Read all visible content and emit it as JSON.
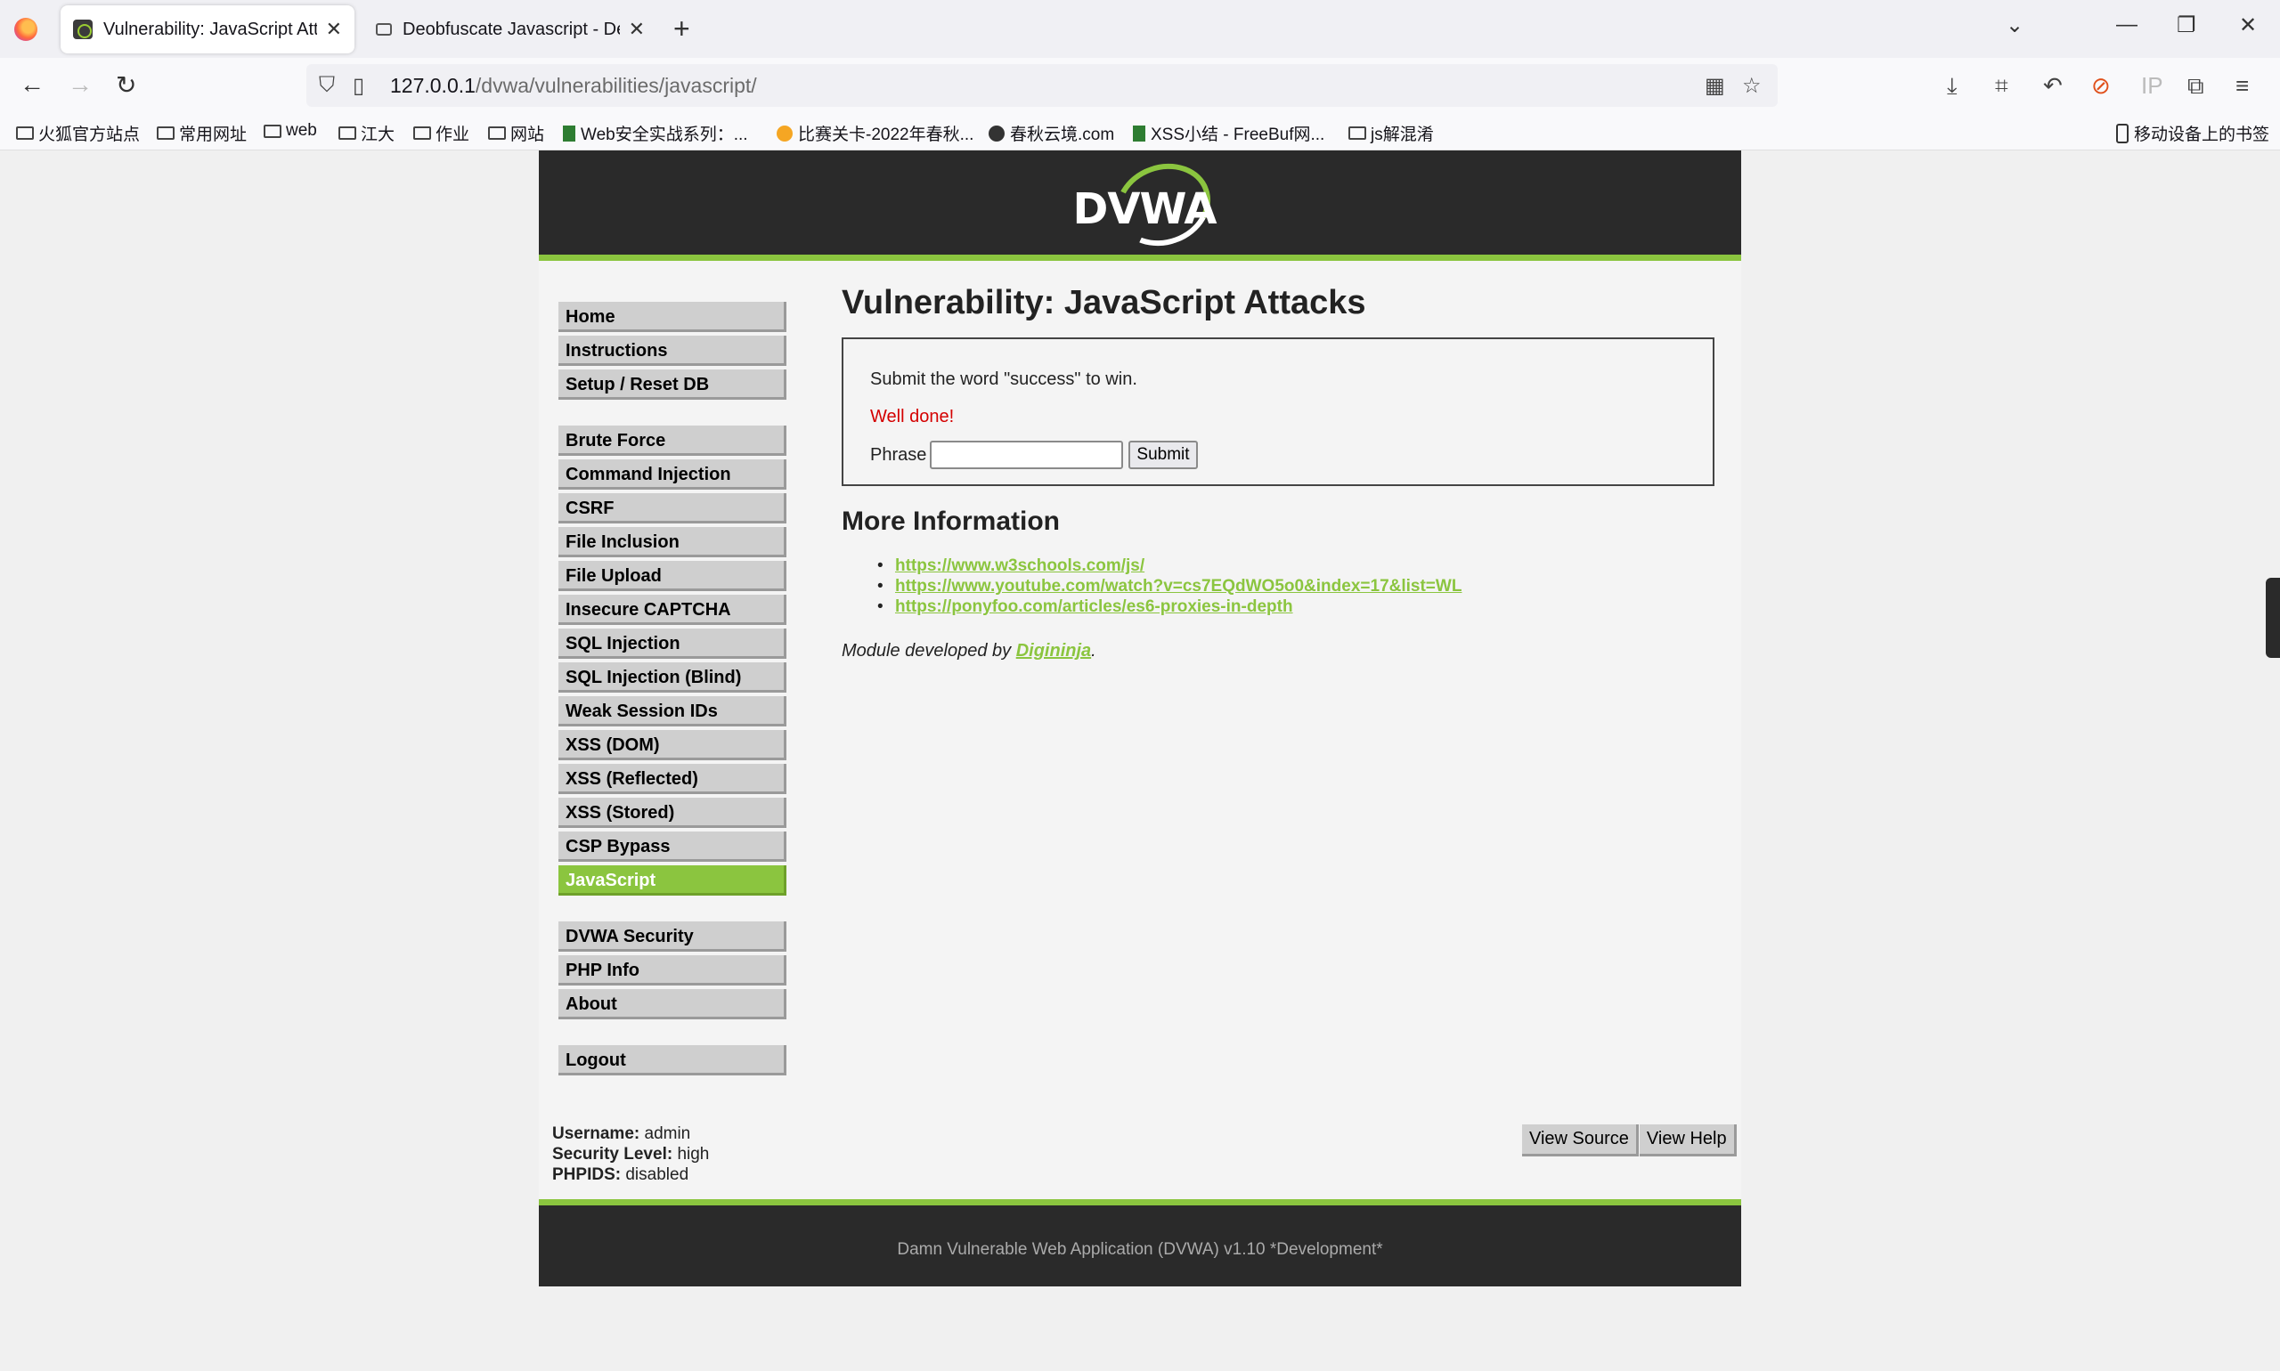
{
  "browser": {
    "tabs": [
      {
        "title": "Vulnerability: JavaScript Attac",
        "active": true
      },
      {
        "title": "Deobfuscate Javascript - Deo",
        "active": false
      }
    ],
    "new_tab": "+",
    "controls": {
      "list": "⌄",
      "minimize": "—",
      "restore": "❐",
      "close": "✕"
    },
    "url": {
      "host": "127.0.0.1",
      "path": "/dvwa/vulnerabilities/javascript/"
    },
    "toolbar_ip": "IP",
    "bookmarks": [
      {
        "label": "火狐官方站点",
        "icon": "folder-icon"
      },
      {
        "label": "常用网址",
        "icon": "folder-icon"
      },
      {
        "label": "web",
        "icon": "folder-icon"
      },
      {
        "label": "江大",
        "icon": "folder-icon"
      },
      {
        "label": "作业",
        "icon": "folder-icon"
      },
      {
        "label": "网站",
        "icon": "folder-icon"
      },
      {
        "label": "Web安全实战系列：...",
        "icon": "site-icon"
      },
      {
        "label": "比赛关卡-2022年春秋...",
        "icon": "site-icon"
      },
      {
        "label": "春秋云境.com",
        "icon": "site-icon"
      },
      {
        "label": "XSS小结 - FreeBuf网...",
        "icon": "site-icon"
      },
      {
        "label": "js解混淆",
        "icon": "folder-icon"
      },
      {
        "label": "移动设备上的书签",
        "icon": "phone-icon"
      }
    ]
  },
  "dvwa": {
    "logo": "DVWA",
    "menu": {
      "group1": [
        "Home",
        "Instructions",
        "Setup / Reset DB"
      ],
      "group2": [
        "Brute Force",
        "Command Injection",
        "CSRF",
        "File Inclusion",
        "File Upload",
        "Insecure CAPTCHA",
        "SQL Injection",
        "SQL Injection (Blind)",
        "Weak Session IDs",
        "XSS (DOM)",
        "XSS (Reflected)",
        "XSS (Stored)",
        "CSP Bypass",
        "JavaScript"
      ],
      "group3": [
        "DVWA Security",
        "PHP Info",
        "About"
      ],
      "group4": [
        "Logout"
      ],
      "selected": "JavaScript"
    },
    "title": "Vulnerability: JavaScript Attacks",
    "instructions": "Submit the word \"success\" to win.",
    "message": "Well done!",
    "phrase_label": "Phrase",
    "phrase_value": "",
    "submit_label": "Submit",
    "more_info_title": "More Information",
    "links": [
      "https://www.w3schools.com/js/",
      "https://www.youtube.com/watch?v=cs7EQdWO5o0&index=17&list=WL",
      "https://ponyfoo.com/articles/es6-proxies-in-depth"
    ],
    "credit_prefix": "Module developed by ",
    "credit_author": "Digininja",
    "credit_suffix": ".",
    "user": {
      "username_label": "Username:",
      "username": "admin",
      "security_label": "Security Level:",
      "security": "high",
      "phpids_label": "PHPIDS:",
      "phpids": "disabled"
    },
    "view_source": "View Source",
    "view_help": "View Help",
    "footer": "Damn Vulnerable Web Application (DVWA) v1.10 *Development*"
  }
}
